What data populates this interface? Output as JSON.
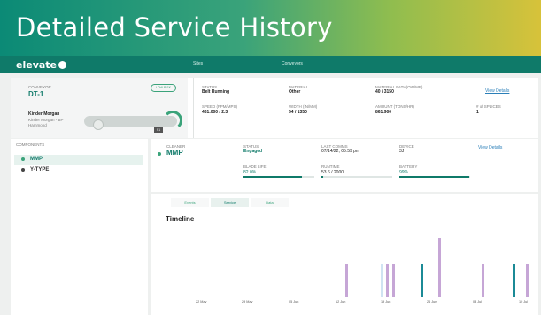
{
  "banner": {
    "title": "Detailed Service History"
  },
  "appbar": {
    "logo": "elevate",
    "nav": [
      "Sites",
      "Conveyors"
    ]
  },
  "conveyor_card": {
    "label": "CONVEYOR",
    "name": "DT-1",
    "badge": "LOW RISK",
    "site_name": "Kinder Morgan",
    "site_sub1": "Kinder Morgan - BP",
    "site_sub2": "Hammond",
    "tag": "S1"
  },
  "summary": {
    "status_label": "STATUS",
    "status_value": "Belt Running",
    "material_label": "MATERIAL",
    "material_value": "Other",
    "path_label": "MATERIAL PATH(OW/MB)",
    "path_value": "40 / 3150",
    "speed_label": "SPEED (FPM/MPS)",
    "speed_value": "461.000 / 2.3",
    "width_label": "WIDTH (IN/MM)",
    "width_value": "54 / 1350",
    "amount_label": "AMOUNT (TONS/HR)",
    "amount_value": "861.900",
    "splices_label": "# of SPLICES",
    "splices_value": "1",
    "view_details": "View Details"
  },
  "components": {
    "header": "COMPONENTS",
    "items": [
      {
        "label": "MMP",
        "color": "#3aa37a",
        "selected": true
      },
      {
        "label": "Y-TYPE",
        "color": "#444444",
        "selected": false
      }
    ]
  },
  "detail": {
    "cleaner_label": "CLEANER",
    "cleaner_value": "MMP",
    "status_label": "STATUS",
    "status_value": "Engaged",
    "comm_label": "LAST COMMS",
    "comm_value": "07/14/22, 05:59 pm",
    "device_label": "DEVICE",
    "device_value": "3J",
    "view_details": "View Details",
    "blade_label": "BLADE LIFE",
    "blade_value": "82.0%",
    "blade_pct": 0.82,
    "runtime_label": "RUNTIME",
    "runtime_value": "53.6 / 2000",
    "runtime_pct": 0.03,
    "battery_label": "BATTERY",
    "battery_value": "99%",
    "battery_pct": 0.99
  },
  "timeline": {
    "tabs": [
      "Events",
      "Service",
      "Data"
    ],
    "active_tab": "Service",
    "title": "Timeline",
    "x_labels": [
      "22 May",
      "29 May",
      "05 Jun",
      "12 Jun",
      "19 Jun",
      "26 Jun",
      "03 Jul",
      "10 Jul"
    ],
    "colors": {
      "purple": "#c6a6d6",
      "teal": "#1b8a96",
      "light": "#cfe3f2"
    }
  }
}
